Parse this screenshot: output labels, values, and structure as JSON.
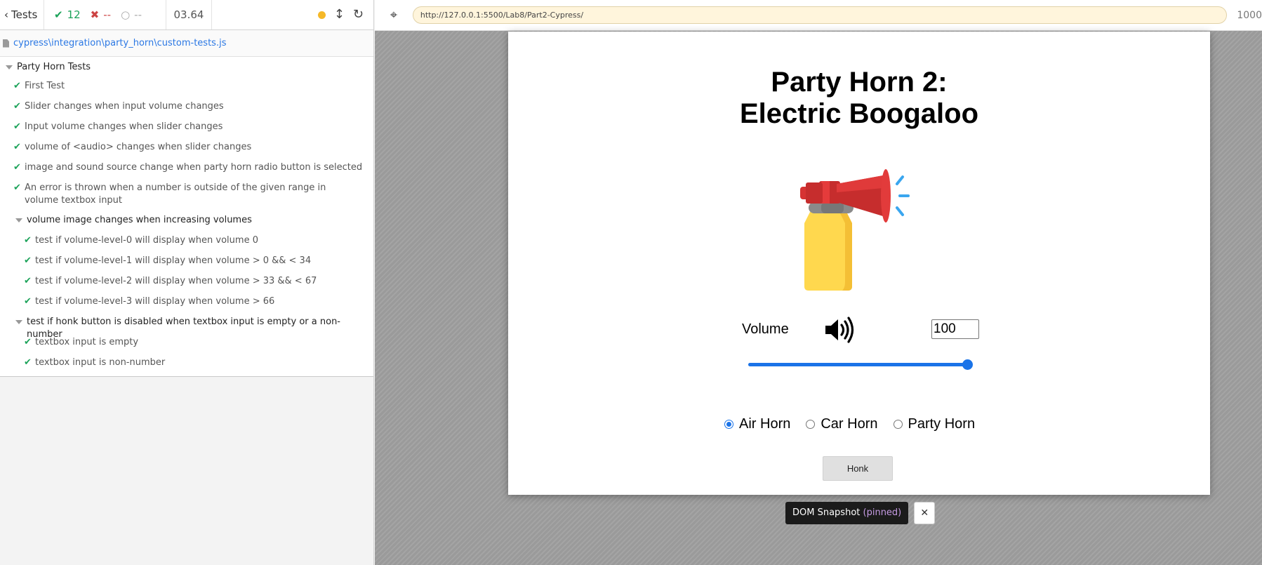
{
  "reporter": {
    "back_label": "Tests",
    "passed": "12",
    "failed": "--",
    "pending": "--",
    "duration": "03.64",
    "spec_path": "cypress\\integration\\party_horn\\custom-tests.js",
    "suite": {
      "title": "Party Horn Tests",
      "tests": [
        "First Test",
        "Slider changes when input volume changes",
        "Input volume changes when slider changes",
        "volume of <audio> changes when slider changes",
        "image and sound source change when party horn radio button is selected",
        "An error is thrown when a number is outside of the given range in volume textbox input"
      ],
      "subsuites": [
        {
          "title": "volume image changes when increasing volumes",
          "tests": [
            "test if volume-level-0 will display when volume 0",
            "test if volume-level-1 will display when volume > 0 && < 34",
            "test if volume-level-2 will display when volume > 33 && < 67",
            "test if volume-level-3 will display when volume > 66"
          ]
        },
        {
          "title": "test if honk button is disabled when textbox input is empty or a non-number",
          "tests": [
            "textbox input is empty",
            "textbox input is non-number"
          ]
        }
      ]
    }
  },
  "aut": {
    "url": "http://127.0.0.1:5500/Lab8/Part2-Cypress/",
    "viewport": "1000",
    "page": {
      "title_line1": "Party Horn 2:",
      "title_line2": "Electric Boogaloo",
      "horn_image": "air-horn-image",
      "volume_label": "Volume",
      "volume_icon": "volume-level-3-icon",
      "volume_value": "100",
      "slider_fraction": 1.0,
      "radios": [
        {
          "label": "Air Horn",
          "checked": true
        },
        {
          "label": "Car Horn",
          "checked": false
        },
        {
          "label": "Party Horn",
          "checked": false
        }
      ],
      "honk_label": "Honk"
    },
    "snapshot": {
      "label": "DOM Snapshot",
      "pinned": "(pinned)",
      "close": "✕"
    }
  },
  "colors": {
    "pass": "#1ca35a",
    "fail": "#cc4444",
    "link": "#2b78e4",
    "accent": "#1a73e8",
    "running_dot": "#f5b828"
  }
}
